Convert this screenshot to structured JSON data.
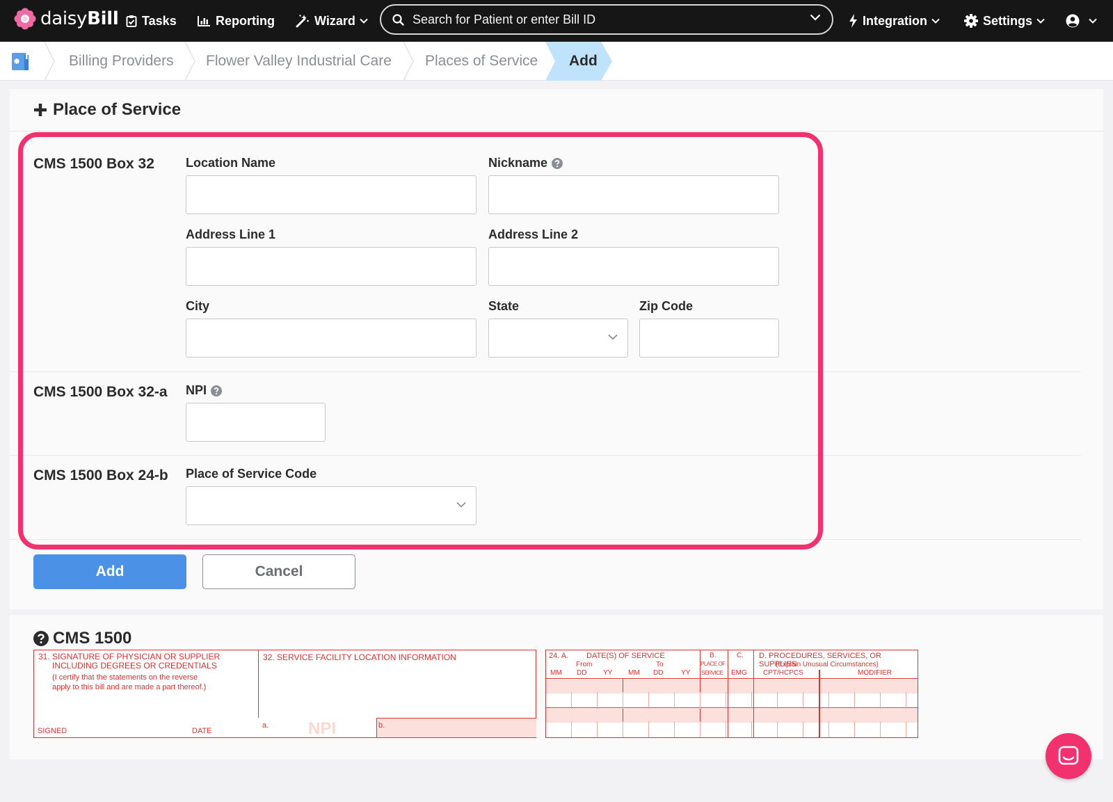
{
  "nav": {
    "brand_light": "daisy",
    "brand_bold": "Bill",
    "tasks": "Tasks",
    "reporting": "Reporting",
    "wizard": "Wizard",
    "search_placeholder": "Search for Patient or enter Bill ID",
    "integration": "Integration",
    "settings": "Settings"
  },
  "breadcrumb": {
    "items": [
      "Billing Providers",
      "Flower Valley Industrial Care",
      "Places of Service",
      "Add"
    ]
  },
  "form": {
    "title": "Place of Service",
    "box32": {
      "section": "CMS 1500 Box 32",
      "location_name": "Location Name",
      "nickname": "Nickname",
      "address1": "Address Line 1",
      "address2": "Address Line 2",
      "city": "City",
      "state": "State",
      "zip": "Zip Code"
    },
    "box32a": {
      "section": "CMS 1500 Box 32-a",
      "npi": "NPI"
    },
    "box24b": {
      "section": "CMS 1500 Box 24-b",
      "pos_code": "Place of Service Code"
    },
    "add_button": "Add",
    "cancel_button": "Cancel"
  },
  "cms1500": {
    "title": "CMS 1500",
    "box31_line1": "31. SIGNATURE OF PHYSICIAN OR SUPPLIER",
    "box31_line2": "INCLUDING DEGREES OR CREDENTIALS",
    "box31_line3": "(I certify that the statements on the reverse",
    "box31_line4": "apply to this bill and are made a part thereof.)",
    "signed": "SIGNED",
    "date": "DATE",
    "box32_title": "32. SERVICE FACILITY LOCATION INFORMATION",
    "box32_a": "a.",
    "box32_npi": "NPI",
    "box32_b": "b.",
    "box24_a": "24. A.",
    "dates_of_service": "DATE(S) OF SERVICE",
    "from": "From",
    "to": "To",
    "mm": "MM",
    "dd": "DD",
    "yy": "YY",
    "b_label": "B.",
    "place_of": "PLACE OF",
    "service": "SERVICE",
    "c_label": "C.",
    "emg": "EMG",
    "d_label": "D. PROCEDURES, SERVICES, OR SUPPLIES",
    "explain": "(Explain Unusual Circumstances)",
    "cpt": "CPT/HCPCS",
    "modifier": "MODIFIER"
  },
  "colors": {
    "accent_pink": "#f2316f",
    "primary_blue": "#4b92e6",
    "crumb_active": "#bfe3fb",
    "form_red": "#e03030",
    "form_fill": "#fbe0dc"
  }
}
